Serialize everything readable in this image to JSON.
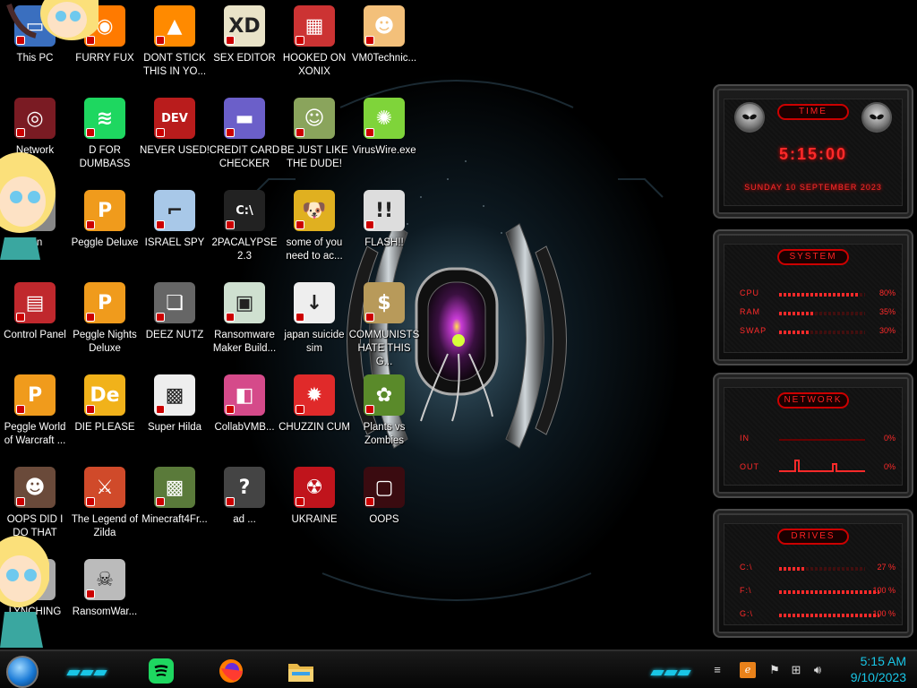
{
  "desktop": {
    "icons": [
      {
        "label": "This PC",
        "icon": "this-pc-icon"
      },
      {
        "label": "FURRY FUX",
        "icon": "firefox-icon"
      },
      {
        "label": "DONT STICK THIS IN YO...",
        "icon": "vlc-cone-icon"
      },
      {
        "label": "SEX EDITOR",
        "icon": "hxd-icon"
      },
      {
        "label": "HOOKED ON XONIX",
        "icon": "xonix-icon"
      },
      {
        "label": "VM0Technic...",
        "icon": "technician-icon"
      },
      {
        "label": "Network",
        "icon": "network-icon"
      },
      {
        "label": "D FOR DUMBASS",
        "icon": "spotify-icon"
      },
      {
        "label": "NEVER USED!",
        "icon": "devcpp-icon"
      },
      {
        "label": "CREDIT CARD CHECKER",
        "icon": "credit-card-icon"
      },
      {
        "label": "BE JUST LIKE THE DUDE!",
        "icon": "dude-icon"
      },
      {
        "label": "VirusWire.exe",
        "icon": "limewire-icon"
      },
      {
        "label": "Bin",
        "icon": "recycle-bin-icon"
      },
      {
        "label": "Peggle Deluxe",
        "icon": "peggle-icon"
      },
      {
        "label": "ISRAEL SPY",
        "icon": "spy-icon"
      },
      {
        "label": "2PACALYPSE 2.3",
        "icon": "terminal-icon"
      },
      {
        "label": "some of you need to ac...",
        "icon": "dog-icon"
      },
      {
        "label": "FLASH!!",
        "icon": "flash-icon"
      },
      {
        "label": "Control Panel",
        "icon": "control-panel-icon"
      },
      {
        "label": "Peggle Nights Deluxe",
        "icon": "peggle-icon"
      },
      {
        "label": "DEEZ NUTZ",
        "icon": "windows-stack-icon"
      },
      {
        "label": "Ransomware Maker Build...",
        "icon": "ransomware-maker-icon"
      },
      {
        "label": "japan suicide sim",
        "icon": "japan-sim-icon"
      },
      {
        "label": "COMMUNISTS HATE THIS G...",
        "icon": "money-bag-icon"
      },
      {
        "label": "Peggle World of Warcraft ...",
        "icon": "peggle-icon"
      },
      {
        "label": "DIE PLEASE",
        "icon": "die-icon"
      },
      {
        "label": "Super Hilda",
        "icon": "pixel-cat-icon"
      },
      {
        "label": "CollabVMB...",
        "icon": "collabvm-icon"
      },
      {
        "label": "CHUZZIN CUM",
        "icon": "chuzzle-icon"
      },
      {
        "label": "Plants vs Zombies",
        "icon": "pvz-icon"
      },
      {
        "label": "OOPS DID I DO THAT",
        "icon": "portrait-icon"
      },
      {
        "label": "The Legend of Zilda",
        "icon": "zelda-icon"
      },
      {
        "label": "Minecraft4Fr...",
        "icon": "minecraft-icon"
      },
      {
        "label": "ad ...",
        "icon": "unknown-icon"
      },
      {
        "label": "UKRAINE",
        "icon": "radiation-icon"
      },
      {
        "label": "OOPS",
        "icon": "oops-icon"
      },
      {
        "label": "LYNCHING",
        "icon": "lynching-icon"
      },
      {
        "label": "RansomWar...",
        "icon": "skull-icon"
      }
    ]
  },
  "widgets": {
    "time": {
      "title": "TIME",
      "clock": "5:15:00",
      "date": "SUNDAY 10 SEPTEMBER 2023"
    },
    "system": {
      "title": "SYSTEM",
      "rows": [
        {
          "label": "CPU",
          "value": "80%",
          "fill": 0.8
        },
        {
          "label": "RAM",
          "value": "35%",
          "fill": 0.35
        },
        {
          "label": "SWAP",
          "value": "30%",
          "fill": 0.3
        }
      ]
    },
    "network": {
      "title": "NETWORK",
      "rows": [
        {
          "label": "IN",
          "value": "0%"
        },
        {
          "label": "OUT",
          "value": "0%"
        }
      ]
    },
    "drives": {
      "title": "DRIVES",
      "rows": [
        {
          "label": "C:\\",
          "value": "27 %",
          "fill": 0.27
        },
        {
          "label": "F:\\",
          "value": "100 %",
          "fill": 1.0
        },
        {
          "label": "G:\\",
          "value": "100 %",
          "fill": 1.0
        }
      ]
    }
  },
  "taskbar": {
    "pinned": [
      {
        "name": "spotify-taskbar-button",
        "icon": "spotify-icon"
      },
      {
        "name": "firefox-taskbar-button",
        "icon": "firefox-icon"
      },
      {
        "name": "file-explorer-taskbar-button",
        "icon": "folder-icon"
      }
    ],
    "clock_time": "5:15 AM",
    "clock_date": "9/10/2023"
  },
  "colors": {
    "accent_cyan": "#19c6e6",
    "widget_red": "#ff2a2a",
    "background": "#000000"
  }
}
